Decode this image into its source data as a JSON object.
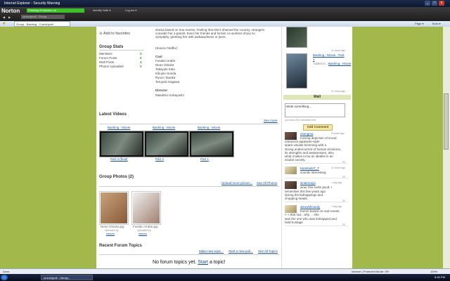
{
  "window": {
    "title": "Internet Explorer - Security Warning",
    "controls": [
      "_",
      "□",
      "x"
    ]
  },
  "norton": {
    "logo": "Norton",
    "status": "Phishing Protection on",
    "identity": "Identity Safe ▾",
    "login": "Log-ins ▾"
  },
  "browser": {
    "address": "crunchyroll - Group ...",
    "tab_label": "Group - Bashing - Crunchyroll",
    "tools": {
      "page": "Page ▾",
      "tools": "Tools ▾"
    }
  },
  "content": {
    "add_favorites": "Add to favorites",
    "group_stats": {
      "title": "Group Stats",
      "rows": [
        {
          "label": "Members",
          "value": "3"
        },
        {
          "label": "Forum Posts",
          "value": "0"
        },
        {
          "label": "Wall Posts",
          "value": "4"
        },
        {
          "label": "Photos Uploaded",
          "value": "2"
        }
      ]
    },
    "description_lines": [
      "drama based on true events. Feeling that she's shamed the country, strangers",
      "consider her a pariah. Even her friends and former co-workers show no",
      "sympathy, greeting her with awkwardness or jeers."
    ],
    "source": "(Source Netflix)",
    "cast": {
      "title": "Cast",
      "names": [
        "Fusako Urabe",
        "Nene Otsuka",
        "Takayuki Kato",
        "Kikujiro Honda",
        "Ryuzo Tanaka",
        "Teruyuki Kagawa"
      ]
    },
    "director": {
      "title": "Director",
      "name": "Masahiro Kobayashi"
    },
    "latest_videos": {
      "title": "Latest Videos",
      "see_more": "See more",
      "items": [
        {
          "title": "Bashing - Movie",
          "part": "Part 3 (final)"
        },
        {
          "title": "Bashing - Movie",
          "part": "Part 2"
        },
        {
          "title": "Bashing - Movie",
          "part": "Part 1"
        }
      ]
    },
    "group_photos": {
      "title": "Group Photos (2)",
      "upload": "Upload more photos...",
      "see_all": "See All Photos",
      "items": [
        {
          "name": "Nene Otsuka.jpg",
          "uploaded_by": "Uploaded by",
          "user": "eaeecvi"
        },
        {
          "name": "Fusako Urabe.jpg",
          "uploaded_by": "Uploaded by",
          "user": "eaeecvi"
        }
      ]
    },
    "forum": {
      "title": "Recent Forum Topics",
      "make_new": "Make new topic...",
      "start_new": "Start a new poll...",
      "see_all": "See All Topics",
      "empty_text": "No forum topics yet.",
      "start_link": "Start",
      "empty_tail": "a topic!"
    }
  },
  "right": {
    "top_video": {
      "time": "11 hours ago"
    },
    "video2": {
      "title": "Bashing - Movie - Part",
      "num": "1",
      "added_by": "Added to",
      "by_link": "Bashing - Movie",
      "time": "11 hours ago"
    },
    "wall": {
      "title": "Wall",
      "placeholder": "Write something...",
      "chars": "you have 240 characters left",
      "button": "Add Comment",
      "posts": [
        {
          "user": "esengma",
          "time": "6 hours ago",
          "lines": [
            "moving depiction of social",
            "ostracism japanese-style",
            "spare visuals brimming with a",
            "strong undercurrent of human emotions,",
            "its strengths and weaknesses, also",
            "what it takes to be an idealist in an",
            "insular society."
          ]
        },
        {
          "user": "tarantadoT_T",
          "time": "11 hours ago",
          "lines": [
            "sounds interesting"
          ]
        },
        {
          "user": "sindemaya",
          "time": "1 day ago",
          "lines": [
            "wow. this looks good. I",
            "remember this few years ago",
            "during the kidnappings and",
            "chopping heads."
          ]
        },
        {
          "user": "alexwithcandy",
          "time": "1 day ago",
          "lines": [
            "humm based on real events",
            "> < that sux.. why . . she",
            "was the one who was kidnapped and",
            "held hostage"
          ]
        }
      ]
    }
  },
  "status": {
    "left": "Done",
    "zone": "Internet | Protected Mode: Off",
    "zoom": "100%"
  },
  "taskbar": {
    "tasks": [
      "crunchyroll - Library..."
    ],
    "clock": "8:46 PM"
  },
  "colors": {
    "page_bg": "#a3b84a",
    "accent_green": "#3fbf2a",
    "link": "#1a53a6"
  }
}
